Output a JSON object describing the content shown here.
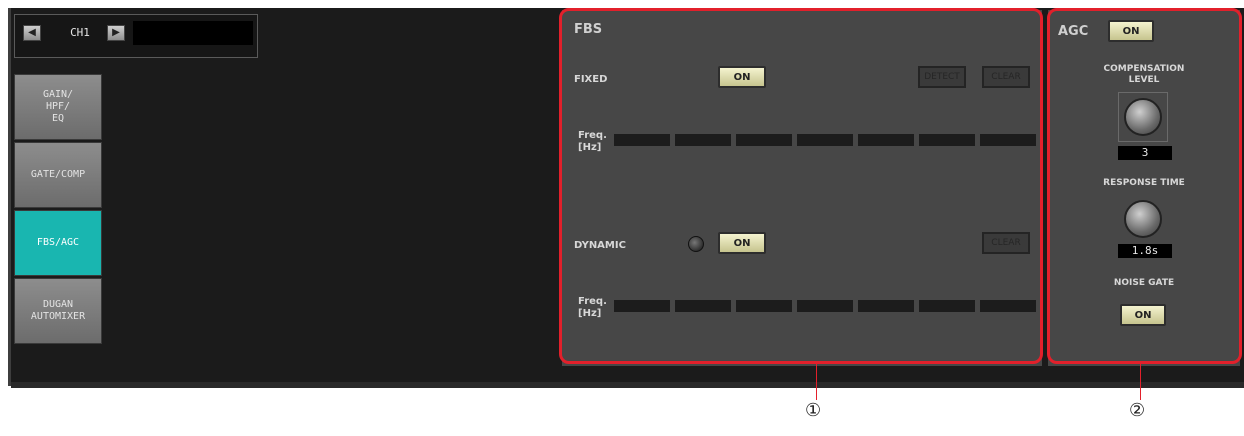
{
  "channel": {
    "prev_icon": "left-arrow-icon",
    "name": "CH1",
    "next_icon": "right-arrow-icon"
  },
  "nav": [
    {
      "label": "GAIN/\nHPF/\nEQ",
      "active": false
    },
    {
      "label": "GATE/COMP",
      "active": false
    },
    {
      "label": "FBS/AGC",
      "active": true
    },
    {
      "label": "DUGAN\nAUTOMIXER",
      "active": false
    }
  ],
  "fbs": {
    "title": "FBS",
    "fixed_label": "FIXED",
    "fixed_on": "ON",
    "detect": "DETECT",
    "clear": "CLEAR",
    "freq_label": "Freq.\n[Hz]",
    "dynamic_label": "DYNAMIC",
    "dynamic_on": "ON",
    "dynamic_clear": "CLEAR",
    "dynamic_freq_label": "Freq.\n[Hz]"
  },
  "agc": {
    "title": "AGC",
    "on": "ON",
    "comp_label": "COMPENSATION\nLEVEL",
    "comp_value": "3",
    "response_label": "RESPONSE TIME",
    "response_value": "1.8s",
    "noise_gate_label": "NOISE GATE",
    "noise_gate_on": "ON"
  },
  "callouts": {
    "fbs": "①",
    "agc": "②"
  },
  "colors": {
    "highlight": "#e2202b",
    "active_tab": "#19b6b0",
    "on_button": "#e8e6b4"
  }
}
